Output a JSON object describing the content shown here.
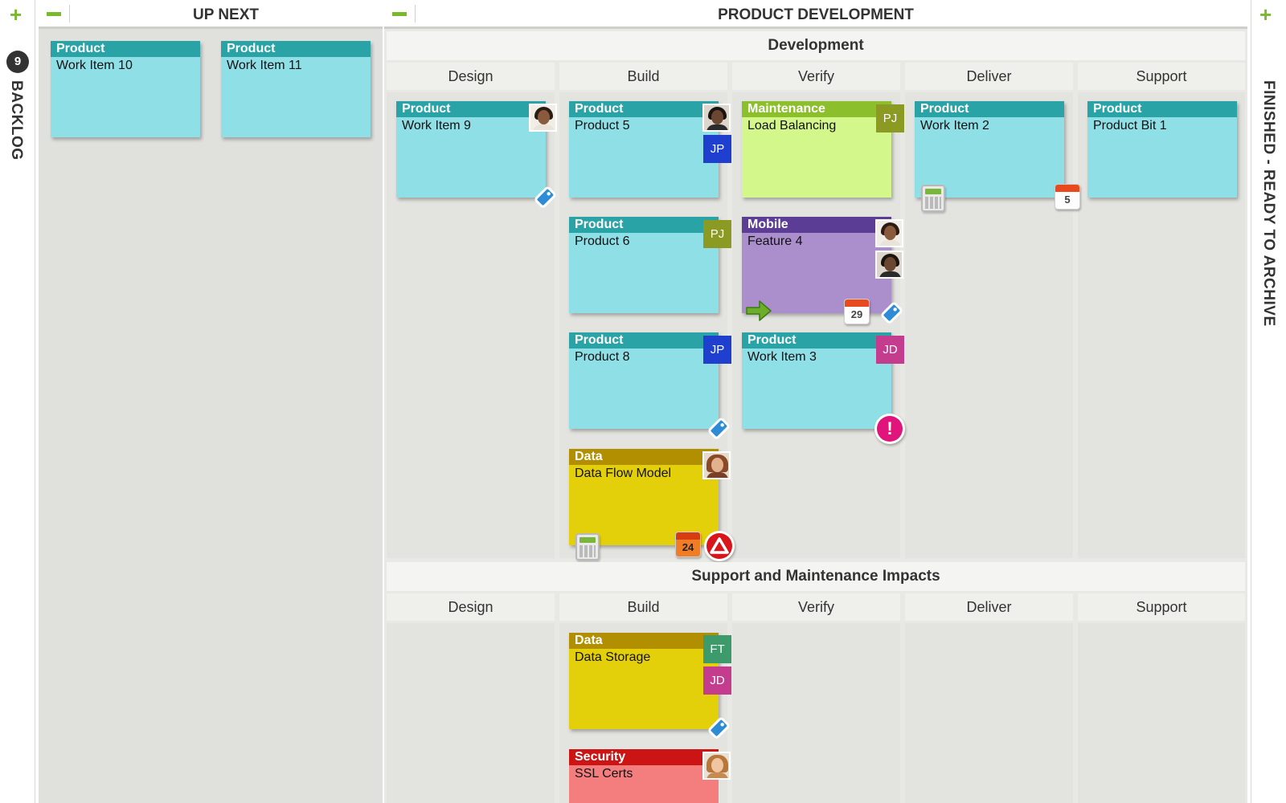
{
  "colors": {
    "accent_green": "#7ab82c",
    "product_head": "#2aa3a7",
    "product_body": "#8fdfe7",
    "maintenance_head": "#8bbf2c",
    "maintenance_body": "#d4f78c",
    "mobile_head": "#5c3d96",
    "mobile_body": "#ab8fcc",
    "data_head": "#b18f00",
    "data_body": "#e3cf0a",
    "security_head": "#cc1414",
    "security_body": "#f47e7e",
    "user_pj": "#8a9a22",
    "user_jp": "#1f3fcf",
    "user_jd": "#c43c8e",
    "user_ft": "#3c9a6b"
  },
  "backlog": {
    "label": "BACKLOG",
    "count": "9",
    "add_icon": "plus-icon"
  },
  "archive": {
    "label": "FINISHED - READY TO ARCHIVE",
    "add_icon": "plus-icon"
  },
  "up_next": {
    "title": "UP NEXT",
    "collapse_icon": "minus-icon",
    "cards": [
      {
        "type": "Product",
        "title": "Work Item 10"
      },
      {
        "type": "Product",
        "title": "Work Item 11"
      }
    ]
  },
  "product_development": {
    "title": "PRODUCT DEVELOPMENT",
    "collapse_icon": "minus-icon",
    "development": {
      "title": "Development",
      "columns": [
        "Design",
        "Build",
        "Verify",
        "Deliver",
        "Support"
      ],
      "cards": {
        "work_item_9": {
          "type": "Product",
          "title": "Work Item 9"
        },
        "product_5": {
          "type": "Product",
          "title": "Product 5",
          "user": "JP"
        },
        "product_6": {
          "type": "Product",
          "title": "Product 6",
          "user": "PJ"
        },
        "product_8": {
          "type": "Product",
          "title": "Product 8",
          "user": "JP"
        },
        "data_flow_model": {
          "type": "Data",
          "title": "Data Flow Model",
          "due_day": "24"
        },
        "load_balancing": {
          "type": "Maintenance",
          "title": "Load Balancing",
          "user": "PJ"
        },
        "feature_4": {
          "type": "Mobile",
          "title": "Feature 4",
          "due_day": "29"
        },
        "work_item_3": {
          "type": "Product",
          "title": "Work Item 3",
          "user": "JD"
        },
        "work_item_2": {
          "type": "Product",
          "title": "Work Item 2",
          "due_day": "5"
        },
        "product_bit_1": {
          "type": "Product",
          "title": "Product Bit 1"
        }
      }
    },
    "impacts": {
      "title": "Support and Maintenance Impacts",
      "columns": [
        "Design",
        "Build",
        "Verify",
        "Deliver",
        "Support"
      ],
      "cards": {
        "data_storage": {
          "type": "Data",
          "title": "Data Storage",
          "users": [
            "FT",
            "JD"
          ]
        },
        "ssl_certs": {
          "type": "Security",
          "title": "SSL Certs"
        }
      }
    }
  }
}
